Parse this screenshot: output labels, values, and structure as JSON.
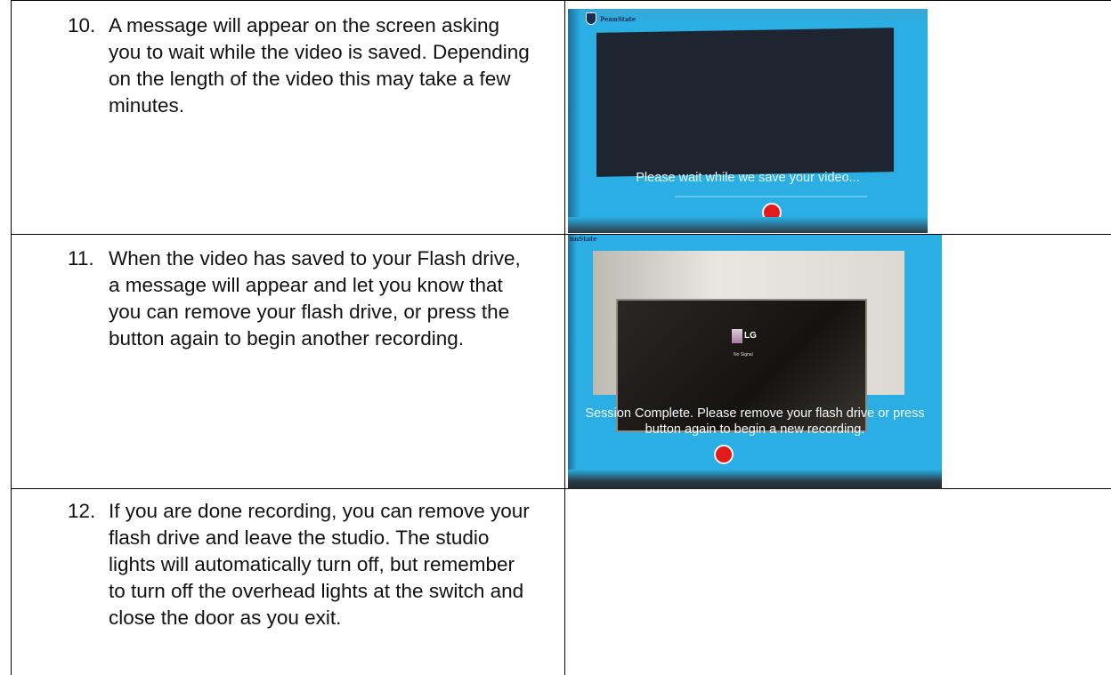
{
  "steps": [
    {
      "number": "10.",
      "text": "A message will appear on the screen asking you to wait while the video is saved. Depending on the length of the video this may take a few minutes."
    },
    {
      "number": "11.",
      "text": "When the video has saved to your Flash drive, a message will appear and let you know that you can remove your flash drive, or press the button again to begin another recording."
    },
    {
      "number": "12.",
      "text": "If you are done recording, you can remove your flash drive and leave the studio. The studio lights will automatically turn off, but remember to turn off the overhead lights at the switch and close the door as you exit."
    }
  ],
  "photo_1": {
    "logo_text": "PennState",
    "message": "Please wait while we save your video..."
  },
  "photo_2": {
    "logo_text": "nnState",
    "tv_brand": "LG",
    "tv_status": "No Signal",
    "message_line_1": "Session Complete. Please remove your flash drive or press",
    "message_line_2": "button again to begin a new recording."
  },
  "colors": {
    "screen_blue": "#2aaee3",
    "record_red": "#e21b1b",
    "border": "#000000"
  }
}
